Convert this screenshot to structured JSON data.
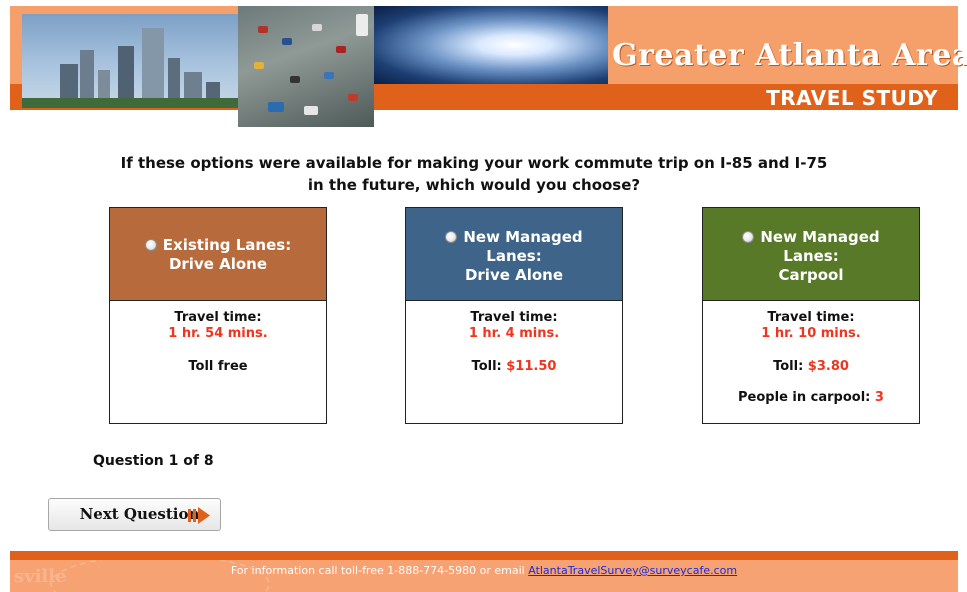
{
  "header": {
    "title": "Greater Atlanta Area",
    "subtitle": "TRAVEL STUDY"
  },
  "question": {
    "text": "If these options were available for making your work commute trip on I-85 and I-75 in the future, which would you choose?"
  },
  "options": [
    {
      "label_line1": "Existing Lanes:",
      "label_line2": "Drive Alone",
      "travel_time_label": "Travel time:",
      "travel_time": "1 hr. 54 mins.",
      "toll_text": "Toll free",
      "header_color": "#b76b3c"
    },
    {
      "label_line1": "New Managed",
      "label_line2": "Lanes:",
      "label_line3": "Drive Alone",
      "travel_time_label": "Travel time:",
      "travel_time": "1 hr. 4 mins.",
      "toll_label": "Toll:",
      "toll_value": "$11.50",
      "header_color": "#3f6489"
    },
    {
      "label_line1": "New Managed",
      "label_line2": "Lanes:",
      "label_line3": "Carpool",
      "travel_time_label": "Travel time:",
      "travel_time": "1 hr. 10 mins.",
      "toll_label": "Toll:",
      "toll_value": "$3.80",
      "carpool_label": "People in carpool:",
      "carpool_value": "3",
      "header_color": "#587a28"
    }
  ],
  "progress": {
    "text": "Question 1 of 8"
  },
  "next_button": {
    "label": "Next Question",
    "icon": "arrow-right-icon"
  },
  "footer": {
    "info_text": "For information call toll-free 1-888-774-5980 or email",
    "email": "AtlantaTravelSurvey@surveycafe.com",
    "watermark": "sville"
  },
  "colors": {
    "accent_orange": "#e0621a",
    "header_band": "#f5a06a",
    "highlight_red": "#f0341e",
    "link_blue": "#1a2bd6"
  }
}
